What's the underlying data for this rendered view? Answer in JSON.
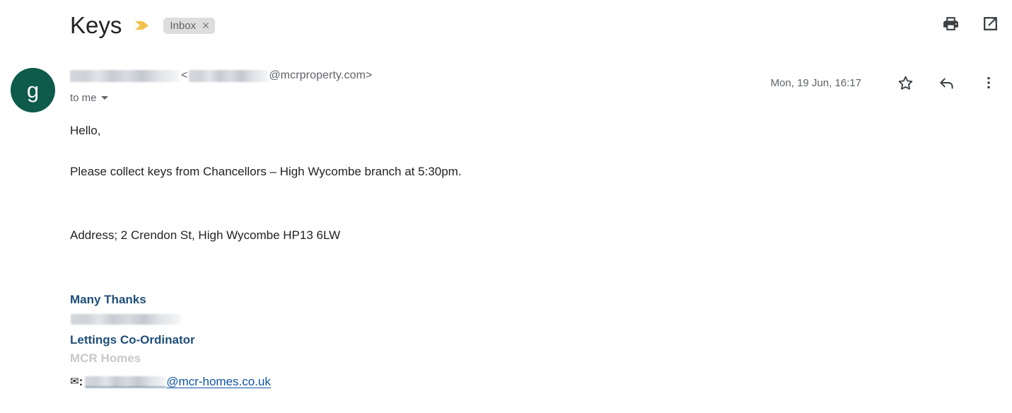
{
  "header": {
    "subject": "Keys",
    "important_marker_icon": "important-chevron-icon",
    "label_chip": {
      "text": "Inbox",
      "remove_icon": "close-x-icon"
    },
    "actions": [
      {
        "name": "print-button",
        "icon": "print-icon"
      },
      {
        "name": "open-in-new-window-button",
        "icon": "external-link-icon"
      }
    ]
  },
  "message": {
    "avatar": {
      "initial": "g",
      "color": "#0e5a4b"
    },
    "sender": {
      "name_redacted": true,
      "angle_open": "<",
      "email_local_redacted": true,
      "email_domain": "@mcrproperty.com>"
    },
    "recipients": {
      "label": "to me",
      "expand_icon": "caret-down-icon"
    },
    "timestamp": "Mon, 19 Jun, 16:17",
    "actions": [
      {
        "name": "star-button",
        "icon": "star-icon"
      },
      {
        "name": "reply-button",
        "icon": "reply-arrow-icon"
      },
      {
        "name": "more-options-button",
        "icon": "three-dots-vertical-icon"
      }
    ],
    "body": {
      "greeting": "Hello,",
      "paragraph": "Please collect keys from Chancellors – High Wycombe branch at 5:30pm.",
      "address": "Address; 2 Crendon St, High Wycombe HP13 6LW"
    },
    "signature": {
      "closing": "Many Thanks",
      "name_redacted": true,
      "job_title": "Lettings Co-Ordinator",
      "company": "MCR Homes",
      "email": {
        "envelope_icon": "envelope-icon",
        "separator": ":",
        "local_redacted": true,
        "domain": "@mcr-homes.co.uk"
      }
    }
  },
  "colors": {
    "signature_blue": "#1f4e79",
    "link_blue": "#1155a3",
    "company_gray": "#c6c8ca",
    "avatar_green": "#0e5a4b",
    "important_yellow": "#f2c14e",
    "chip_gray": "#dddddd",
    "text_dark": "#202124",
    "text_muted": "#5f6368"
  }
}
